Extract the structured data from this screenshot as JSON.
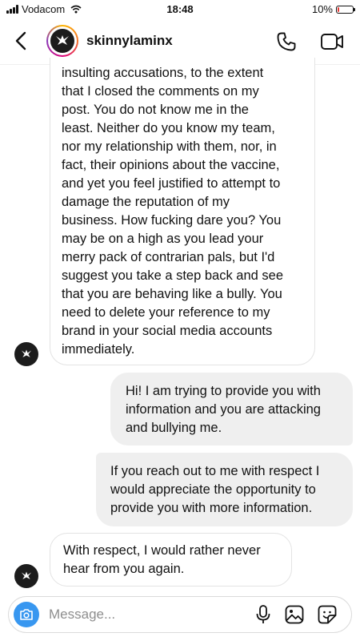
{
  "status_bar": {
    "carrier": "Vodacom",
    "time": "18:48",
    "battery": "10%",
    "battery_level": 0.1,
    "battery_color": "#e53935"
  },
  "header": {
    "username": "skinnylaminx",
    "back_icon": "chevron-left-icon",
    "call_icon": "phone-icon",
    "video_icon": "video-camera-icon",
    "story_ring_colors": [
      "#fdb600",
      "#f5732a",
      "#d9007c",
      "#8a3ab9"
    ]
  },
  "messages": [
    {
      "direction": "incoming",
      "lines": [
        "insulting accusations, to the extent",
        "that I closed the comments on my",
        "post. You do not know me in the",
        "least. Neither do you know my team,",
        "nor my relationship with them, nor, in",
        "fact, their opinions about the vaccine,",
        "and yet you feel justified to attempt to",
        "damage the reputation of my",
        "business. How fucking dare you? You",
        "may be on a high as you lead your",
        "merry pack of contrarian pals, but I'd",
        "suggest you take a step back and see",
        "that you are behaving like a bully. You",
        "need to delete your reference to my",
        "brand in your social media accounts",
        "immediately."
      ]
    },
    {
      "direction": "outgoing",
      "lines": [
        "Hi! I am trying to provide you with",
        "information and you are attacking",
        "and bullying me."
      ]
    },
    {
      "direction": "outgoing",
      "lines": [
        "If you reach out to me with respect I",
        "would appreciate the opportunity to",
        "provide you with more information."
      ]
    },
    {
      "direction": "incoming",
      "lines": [
        "With respect, I would rather never",
        "hear from you again."
      ]
    }
  ],
  "composer": {
    "placeholder": "Message...",
    "camera_icon": "camera-icon",
    "mic_icon": "microphone-icon",
    "gallery_icon": "gallery-icon",
    "sticker_icon": "sticker-icon",
    "camera_color": "#3897f0"
  }
}
